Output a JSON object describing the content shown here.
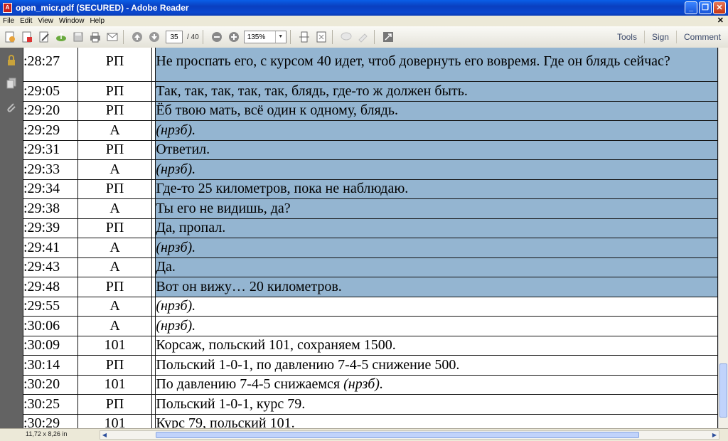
{
  "window": {
    "title": "open_micr.pdf (SECURED) - Adobe Reader",
    "app_icon": "adobe-reader-icon"
  },
  "menu": [
    "File",
    "Edit",
    "View",
    "Window",
    "Help"
  ],
  "toolbar": {
    "page_current": "35",
    "page_total": "/ 40",
    "zoom": "135%",
    "links": [
      "Tools",
      "Sign",
      "Comment"
    ]
  },
  "status": {
    "page_size": "11,72 x 8,26 in"
  },
  "transcript": {
    "rows": [
      {
        "time": ":28:27",
        "speaker": "РП",
        "text": "Не проспать его, с курсом 40 идет, чтоб довернуть его вовремя. Где он блядь сейчас?",
        "italic": false,
        "highlight": true
      },
      {
        "time": ":29:05",
        "speaker": "РП",
        "text": "Так, так, так, так, так, блядь, где-то ж должен быть.",
        "italic": false,
        "highlight": true
      },
      {
        "time": ":29:20",
        "speaker": "РП",
        "text": "Ёб твою мать, всё один к одному, блядь.",
        "italic": false,
        "highlight": true
      },
      {
        "time": ":29:29",
        "speaker": "А",
        "text": "(нрзб).",
        "italic": true,
        "highlight": true
      },
      {
        "time": ":29:31",
        "speaker": "РП",
        "text": "Ответил.",
        "italic": false,
        "highlight": true
      },
      {
        "time": ":29:33",
        "speaker": "А",
        "text": "(нрзб).",
        "italic": true,
        "highlight": true
      },
      {
        "time": ":29:34",
        "speaker": "РП",
        "text": "Где-то 25 километров, пока не наблюдаю.",
        "italic": false,
        "highlight": true
      },
      {
        "time": ":29:38",
        "speaker": "А",
        "text": "Ты его не видишь, да?",
        "italic": false,
        "highlight": true
      },
      {
        "time": ":29:39",
        "speaker": "РП",
        "text": "Да, пропал.",
        "italic": false,
        "highlight": true
      },
      {
        "time": ":29:41",
        "speaker": "А",
        "text": "(нрзб).",
        "italic": true,
        "highlight": true
      },
      {
        "time": ":29:43",
        "speaker": "А",
        "text": "Да.",
        "italic": false,
        "highlight": true
      },
      {
        "time": ":29:48",
        "speaker": "РП",
        "text": "Вот он вижу… 20 километров.",
        "italic": false,
        "highlight": true
      },
      {
        "time": ":29:55",
        "speaker": "А",
        "text": "(нрзб).",
        "italic": true,
        "highlight": false
      },
      {
        "time": ":30:06",
        "speaker": "А",
        "text": "(нрзб).",
        "italic": true,
        "highlight": false
      },
      {
        "time": ":30:09",
        "speaker": "101",
        "text": "Корсаж, польский 101, сохраняем 1500.",
        "italic": false,
        "highlight": false
      },
      {
        "time": ":30:14",
        "speaker": "РП",
        "text": "Польский 1-0-1, по давлению 7-4-5 снижение 500.",
        "italic": false,
        "highlight": false
      },
      {
        "time": ":30:20",
        "speaker": "101",
        "text": "По давлению 7-4-5 снижаемся ",
        "text_italic_suffix": "(нрзб).",
        "italic": false,
        "highlight": false
      },
      {
        "time": ":30:25",
        "speaker": "РП",
        "text": "Польский 1-0-1, курс 79.",
        "italic": false,
        "highlight": false
      },
      {
        "time": ":30:29",
        "speaker": "101",
        "text": "Курс 79, польский 101.",
        "italic": false,
        "highlight": false
      }
    ]
  }
}
